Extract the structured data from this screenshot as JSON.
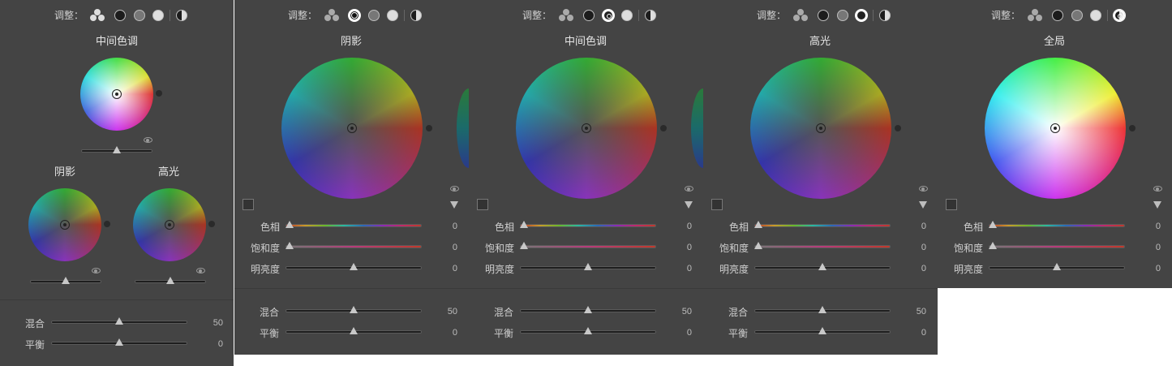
{
  "adjust_label": "调整：",
  "panels": [
    {
      "id": "p1",
      "wheels": {
        "midtone": "中间色调",
        "shadow": "阴影",
        "highlight": "高光"
      },
      "blend": {
        "label": "混合",
        "value": "50"
      },
      "balance": {
        "label": "平衡",
        "value": "0"
      }
    },
    {
      "id": "p2",
      "title": "阴影",
      "hue": {
        "label": "色相",
        "value": "0"
      },
      "saturation": {
        "label": "饱和度",
        "value": "0"
      },
      "luminance": {
        "label": "明亮度",
        "value": "0"
      },
      "blend": {
        "label": "混合",
        "value": "50"
      },
      "balance": {
        "label": "平衡",
        "value": "0"
      }
    },
    {
      "id": "p3",
      "title": "中间色调",
      "hue": {
        "label": "色相",
        "value": "0"
      },
      "saturation": {
        "label": "饱和度",
        "value": "0"
      },
      "luminance": {
        "label": "明亮度",
        "value": "0"
      },
      "blend": {
        "label": "混合",
        "value": "50"
      },
      "balance": {
        "label": "平衡",
        "value": "0"
      }
    },
    {
      "id": "p4",
      "title": "高光",
      "hue": {
        "label": "色相",
        "value": "0"
      },
      "saturation": {
        "label": "饱和度",
        "value": "0"
      },
      "luminance": {
        "label": "明亮度",
        "value": "0"
      },
      "blend": {
        "label": "混合",
        "value": "50"
      },
      "balance": {
        "label": "平衡",
        "value": "0"
      }
    },
    {
      "id": "p5",
      "title": "全局",
      "hue": {
        "label": "色相",
        "value": "0"
      },
      "saturation": {
        "label": "饱和度",
        "value": "0"
      },
      "luminance": {
        "label": "明亮度",
        "value": "0"
      }
    }
  ],
  "icons": {
    "three_way": "three-way-view-icon",
    "shadows": "shadows-mode-icon",
    "midtones": "midtones-mode-icon",
    "highlights": "highlights-mode-icon",
    "global": "global-mode-icon",
    "eye": "eye-icon",
    "swatch": "color-swatch-icon",
    "dropdown": "triangle-down-icon"
  },
  "colors": {
    "panel_bg": "#444444",
    "text": "#cfcfcf",
    "track": "#1e1e1e"
  }
}
